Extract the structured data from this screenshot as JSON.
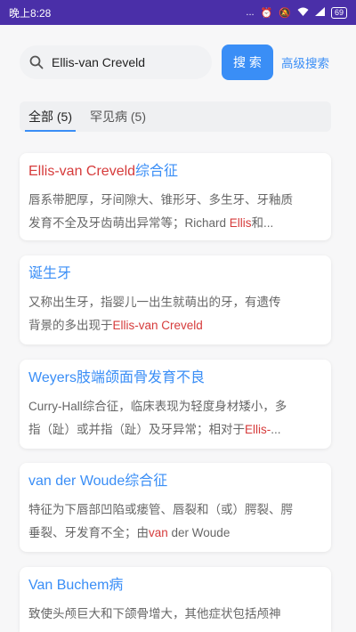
{
  "status": {
    "time": "晚上8:28",
    "signal": "...",
    "battery": "69"
  },
  "search": {
    "query": "Ellis-van Creveld",
    "button": "搜 索",
    "advanced": "高级搜索"
  },
  "tabs": [
    {
      "label": "全部 (5)"
    },
    {
      "label": "罕见病 (5)"
    }
  ],
  "results": [
    {
      "title_hl": "Ellis-van Creveld",
      "title_rest": "综合征",
      "desc1": "唇系带肥厚，牙间隙大、锥形牙、多生牙、牙釉质",
      "desc2a": "发育不全及牙齿萌出异常等；Richard ",
      "desc2hl": "Ellis",
      "desc2b": "和..."
    },
    {
      "title": "诞生牙",
      "desc1": "又称出生牙，指婴儿一出生就萌出的牙，有遗传",
      "desc2a": "背景的多出现于",
      "desc2hl": "Ellis-van Creveld",
      "desc2b": ""
    },
    {
      "title": "Weyers肢端颌面骨发育不良",
      "desc1": "Curry-Hall综合征，临床表现为轻度身材矮小，多",
      "desc2a": "指（趾）或并指（趾）及牙异常；相对于",
      "desc2hl": "Ellis-",
      "desc2b": "..."
    },
    {
      "title": "van der Woude综合征",
      "desc1": "特征为下唇部凹陷或瘘管、唇裂和（或）腭裂、腭",
      "desc2a": "垂裂、牙发育不全；由",
      "desc2hl": "van",
      "desc2b": " der Woude"
    },
    {
      "title": "Van Buchem病",
      "desc1": "致使头颅巨大和下颌骨增大，其他症状包括颅神"
    }
  ]
}
